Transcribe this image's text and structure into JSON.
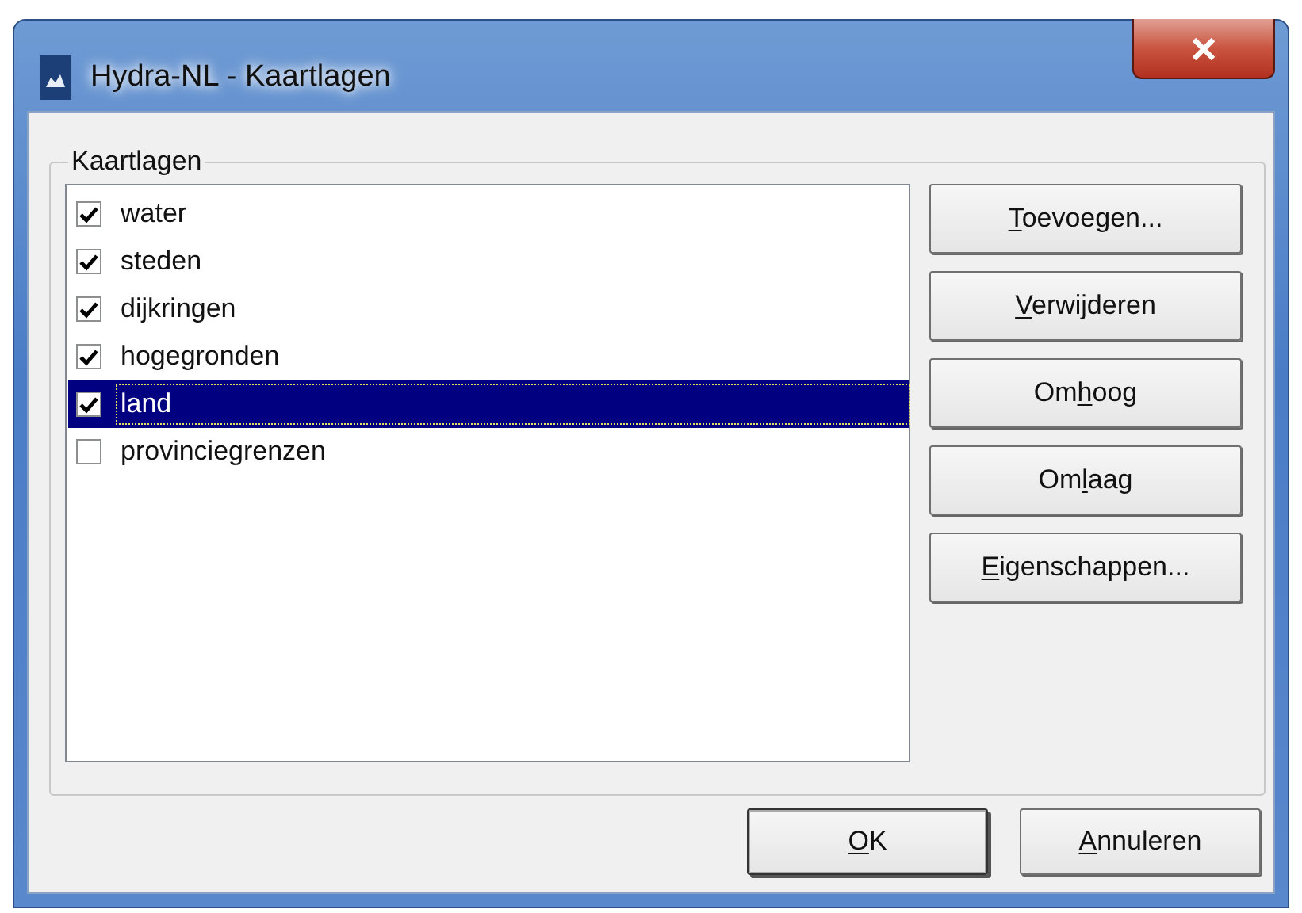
{
  "window": {
    "title": "Hydra-NL - Kaartlagen"
  },
  "group": {
    "label": "Kaartlagen"
  },
  "layers": [
    {
      "name": "water",
      "checked": true,
      "selected": false
    },
    {
      "name": "steden",
      "checked": true,
      "selected": false
    },
    {
      "name": "dijkringen",
      "checked": true,
      "selected": false
    },
    {
      "name": "hogegronden",
      "checked": true,
      "selected": false
    },
    {
      "name": "land",
      "checked": true,
      "selected": true
    },
    {
      "name": "provinciegrenzen",
      "checked": false,
      "selected": false
    }
  ],
  "side_buttons": [
    {
      "key": "T",
      "post": "oevoegen..."
    },
    {
      "key": "V",
      "post": "erwijderen"
    },
    {
      "pre": "Om",
      "key": "h",
      "post": "oog"
    },
    {
      "pre": "Om",
      "key": "l",
      "post": "aag"
    },
    {
      "key": "E",
      "post": "igenschappen..."
    }
  ],
  "footer_buttons": [
    {
      "key": "O",
      "post": "K",
      "default": true
    },
    {
      "key": "A",
      "post": "nnuleren",
      "default": false
    }
  ]
}
